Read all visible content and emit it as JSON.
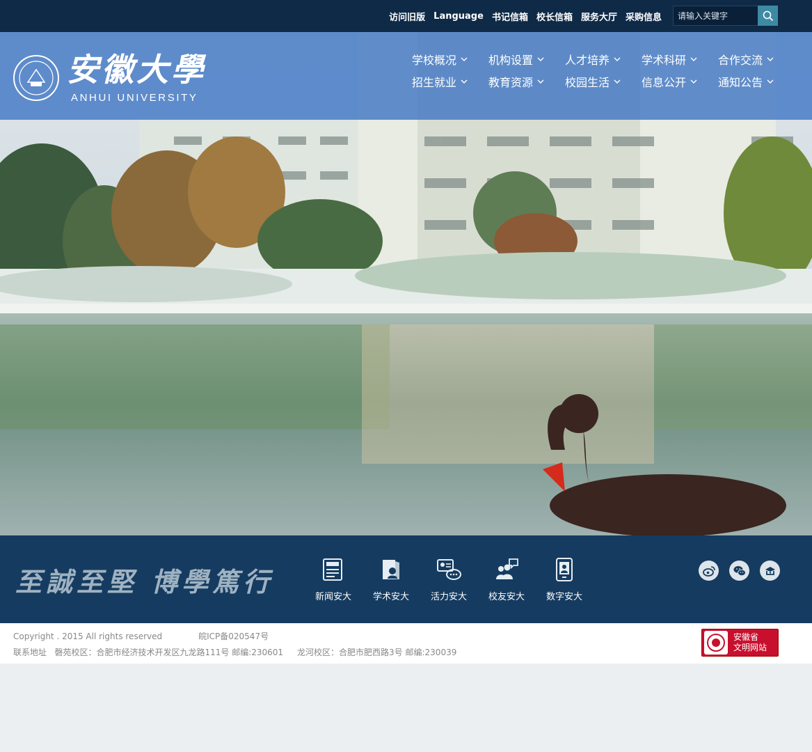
{
  "topbar": {
    "links": [
      "访问旧版",
      "Language",
      "书记信箱",
      "校长信箱",
      "服务大厅",
      "采购信息"
    ],
    "search_placeholder": "请输入关键字"
  },
  "logo": {
    "name_cn": "安徽大學",
    "name_en": "ANHUI UNIVERSITY"
  },
  "nav": [
    "学校概况",
    "机构设置",
    "人才培养",
    "学术科研",
    "合作交流",
    "招生就业",
    "教育资源",
    "校园生活",
    "信息公开",
    "通知公告"
  ],
  "motto": "至誠至堅 博學篤行",
  "quick_links": [
    {
      "label": "新闻安大",
      "icon": "news-icon"
    },
    {
      "label": "学术安大",
      "icon": "book-scholar-icon"
    },
    {
      "label": "活力安大",
      "icon": "chat-people-icon"
    },
    {
      "label": "校友安大",
      "icon": "alumni-group-icon"
    },
    {
      "label": "数字安大",
      "icon": "digital-device-icon"
    }
  ],
  "social": [
    "weibo-icon",
    "wechat-icon",
    "mobile-app-icon"
  ],
  "footer": {
    "copyright": "Copyright . 2015 All rights reserved",
    "icp": "皖ICP备020547号",
    "address_label": "联系地址",
    "campus1": "磬苑校区：合肥市经济技术开发区九龙路111号  邮编:230601",
    "campus2": "龙河校区：合肥市肥西路3号 邮编:230039",
    "badge_line1": "安徽省",
    "badge_line2": "文明网站"
  },
  "colors": {
    "topbar": "#0e2a47",
    "nav_band": "#4278c4",
    "footer_band": "#153b60",
    "search_button": "#3e8aa4"
  }
}
